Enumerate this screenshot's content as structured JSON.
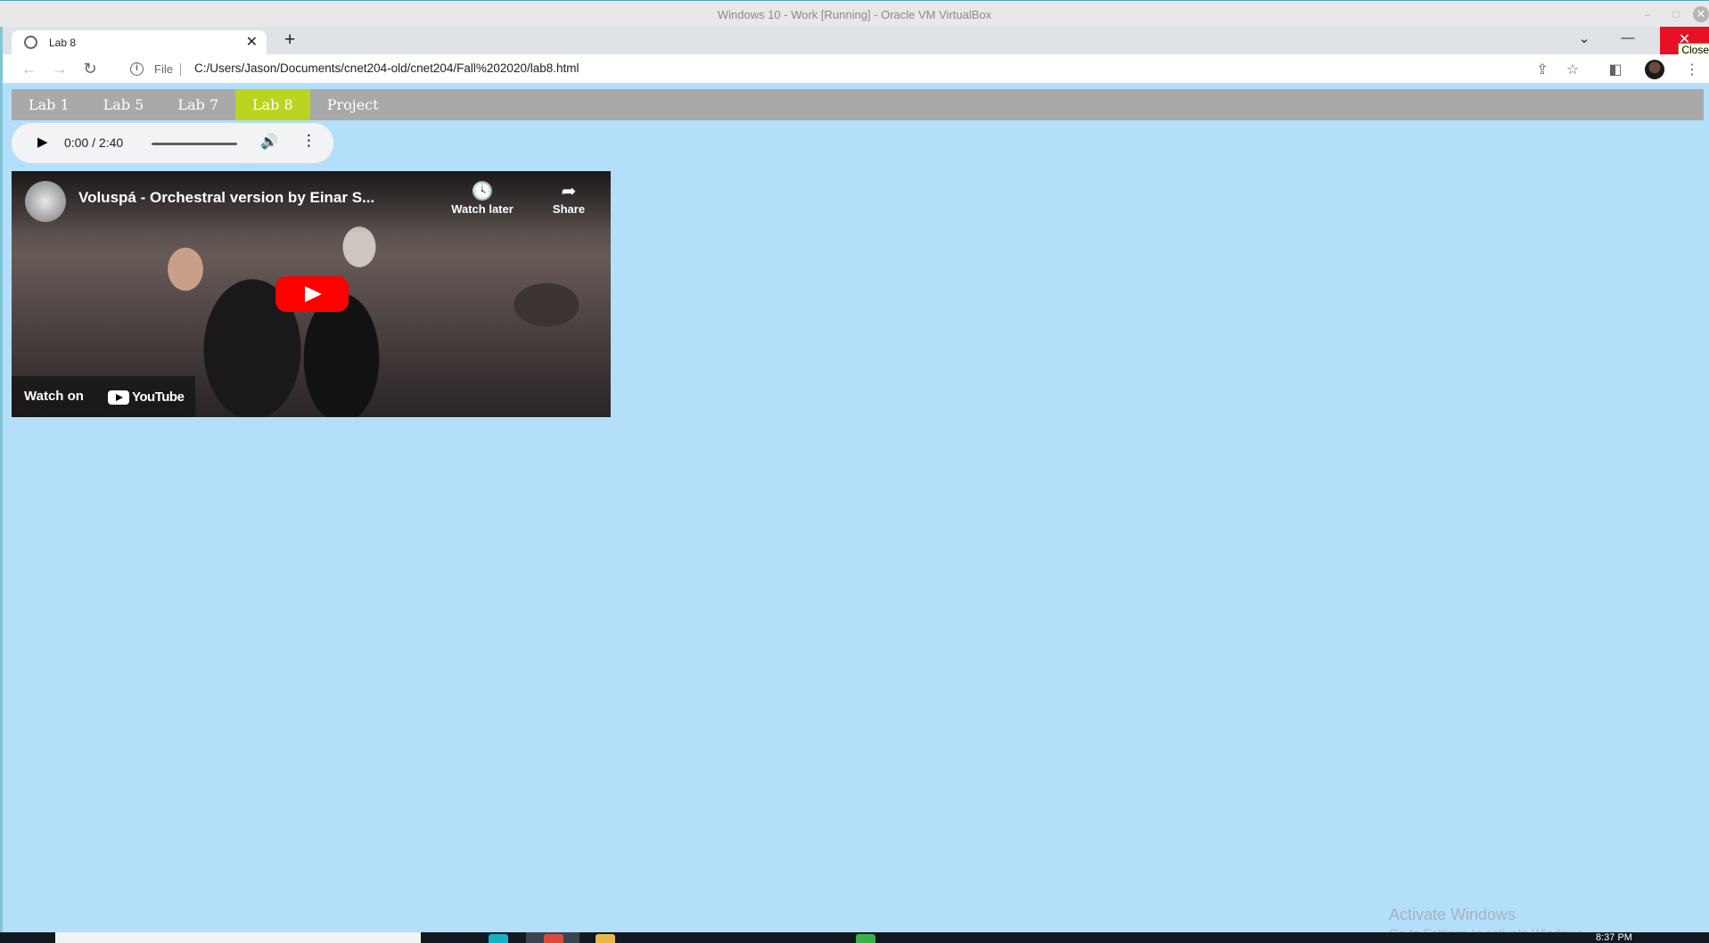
{
  "vbox": {
    "title": "Windows 10 - Work [Running] - Oracle VM VirtualBox",
    "minimize_icon": "–",
    "maximize_icon": "□",
    "close_icon": "✕"
  },
  "browser": {
    "tab": {
      "title": "Lab 8",
      "close_icon": "✕"
    },
    "new_tab_icon": "+",
    "window_controls": {
      "tab_search_icon": "⌄",
      "minimize_icon": "—",
      "restore_icon": "❐",
      "close_icon": "✕",
      "close_tooltip": "Close"
    },
    "toolbar": {
      "back_icon": "←",
      "forward_icon": "→",
      "reload_icon": "↻",
      "info_icon": "i",
      "scheme_label": "File",
      "url": "C:/Users/Jason/Documents/cnet204-old/cnet204/Fall%202020/lab8.html",
      "share_icon": "⇪",
      "bookmark_icon": "☆",
      "side_panel_icon": "◧",
      "menu_icon": "⋮"
    }
  },
  "page": {
    "nav": [
      {
        "label": "Lab 1",
        "active": false
      },
      {
        "label": "Lab 5",
        "active": false
      },
      {
        "label": "Lab 7",
        "active": false
      },
      {
        "label": "Lab 8",
        "active": true
      },
      {
        "label": "Project",
        "active": false
      }
    ],
    "audio": {
      "play_icon": "▶",
      "time": "0:00 / 2:40",
      "volume_icon": "🔊",
      "more_icon": "⋮",
      "progress": 0
    },
    "video": {
      "title": "Voluspá - Orchestral version by Einar S...",
      "watch_later_icon": "🕓",
      "watch_later_label": "Watch later",
      "share_icon": "➦",
      "share_label": "Share",
      "watch_on_label": "Watch on",
      "youtube_wordmark": "YouTube"
    },
    "watermark": {
      "title": "Activate Windows",
      "subtitle": "Go to Settings to activate Windows."
    }
  },
  "taskbar": {
    "clock": "8:37 PM"
  },
  "colors": {
    "page_background": "#b3dffb",
    "nav_background": "#a9a9a9",
    "nav_active": "#bcd321",
    "close_red": "#e81123",
    "youtube_red": "#ff0000"
  }
}
